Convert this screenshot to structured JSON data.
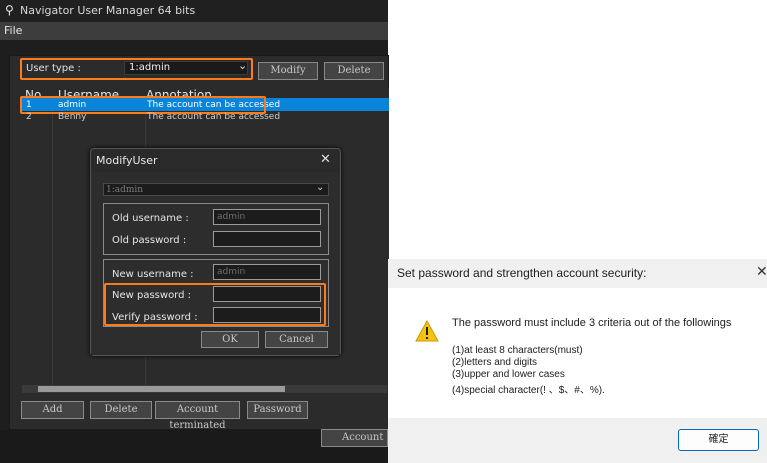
{
  "window": {
    "title": "Navigator User Manager 64 bits",
    "menu": [
      "File"
    ]
  },
  "toolbar": {
    "user_type_label": "User type :",
    "user_type_value": "1:admin",
    "modify_label": "Modify",
    "delete_label": "Delete"
  },
  "table": {
    "headers": {
      "no": "No.",
      "username": "Username",
      "annotation": "Annotation"
    },
    "rows": [
      {
        "no": "1",
        "username": "admin",
        "annotation": "The account can be accessed"
      },
      {
        "no": "2",
        "username": "Benny",
        "annotation": "The account can be accessed"
      }
    ]
  },
  "bottom_buttons": {
    "add": "Add",
    "delete": "Delete",
    "terminated": "Account terminated",
    "password": "Password",
    "account": "Account"
  },
  "modify_dialog": {
    "title": "ModifyUser",
    "user_select": "1:admin",
    "old_username_label": "Old username :",
    "old_username_value": "admin",
    "old_password_label": "Old password :",
    "new_username_label": "New username :",
    "new_username_value": "admin",
    "new_password_label": "New password :",
    "verify_password_label": "Verify password :",
    "ok_label": "OK",
    "cancel_label": "Cancel"
  },
  "security_dialog": {
    "title": "Set password and strengthen account security:",
    "message": "The password must include 3 criteria out of the followings",
    "criteria": [
      "(1)at least 8 characters(must)",
      "(2)letters and digits",
      "(3)upper and lower cases",
      "(4)special character(! 、$、#、%)."
    ],
    "ok_label": "確定"
  },
  "colors": {
    "highlight": "#ff7a1a",
    "selection": "#0a84d8",
    "dialog_accent": "#0067c0"
  }
}
